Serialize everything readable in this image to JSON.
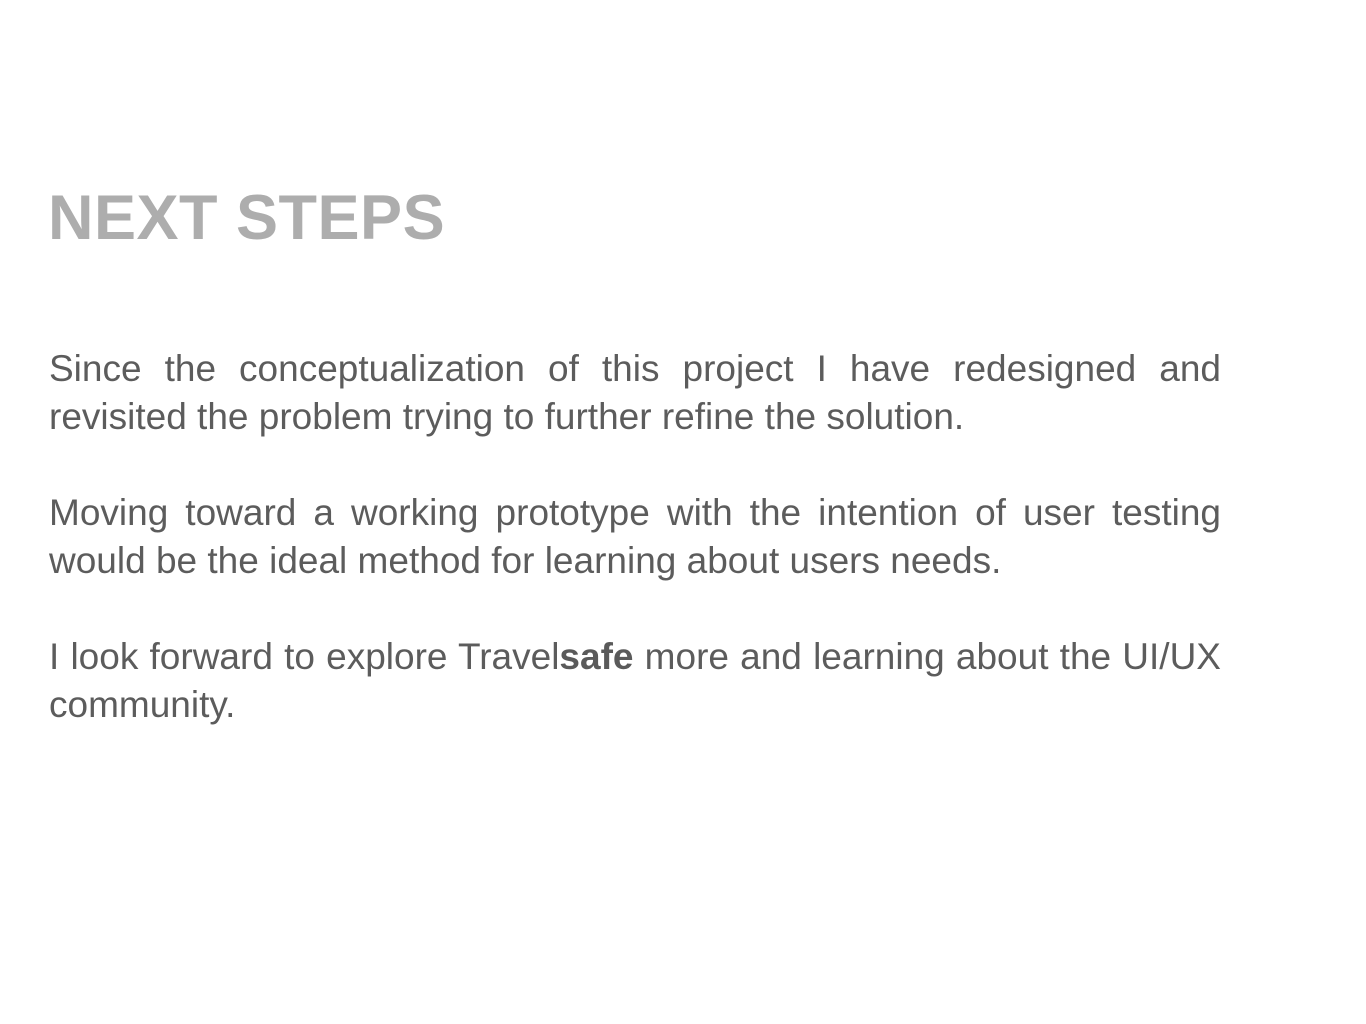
{
  "slide": {
    "title": "NEXT STEPS",
    "paragraph_1": "Since the conceptualization of this project I have redesigned and revisited the problem trying to further refine the solution.",
    "paragraph_2": "Moving toward a working prototype with the intention of user testing would be the ideal method for learning about users needs.",
    "paragraph_3": {
      "before": "I look forward to explore Travel",
      "bold": "safe",
      "after": " more and learning about the UI/UX community."
    }
  },
  "colors": {
    "title": "#adadad",
    "body": "#5c5c5c",
    "background": "#ffffff"
  }
}
